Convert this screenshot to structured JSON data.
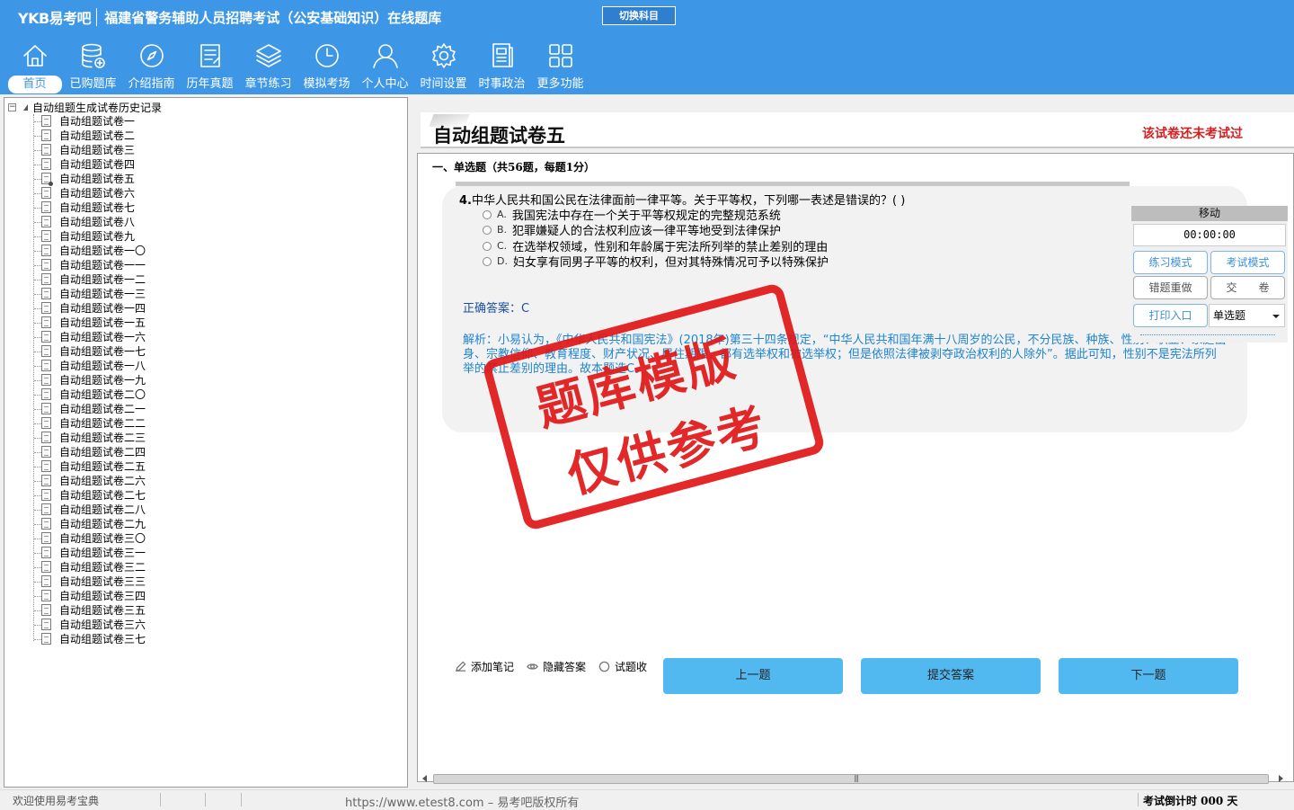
{
  "header": {
    "logo": "YKB易考吧",
    "app_title": "福建省警务辅助人员招聘考试（公安基础知识）在线题库",
    "switch_subject": "切换科目",
    "background_color": "#3d97e6"
  },
  "nav": [
    {
      "label": "首页",
      "icon": "home-icon",
      "active": true
    },
    {
      "label": "已购题库",
      "icon": "database-icon"
    },
    {
      "label": "介绍指南",
      "icon": "compass-icon"
    },
    {
      "label": "历年真题",
      "icon": "document-list-icon"
    },
    {
      "label": "章节练习",
      "icon": "layers-icon"
    },
    {
      "label": "模拟考场",
      "icon": "clock-icon"
    },
    {
      "label": "个人中心",
      "icon": "user-icon"
    },
    {
      "label": "时间设置",
      "icon": "gear-icon"
    },
    {
      "label": "时事政治",
      "icon": "newspaper-icon"
    },
    {
      "label": "更多功能",
      "icon": "grid-icon"
    }
  ],
  "tree": {
    "root_label": "自动组题生成试卷历史记录",
    "items": [
      "自动组题试卷一",
      "自动组题试卷二",
      "自动组题试卷三",
      "自动组题试卷四",
      "自动组题试卷五",
      "自动组题试卷六",
      "自动组题试卷七",
      "自动组题试卷八",
      "自动组题试卷九",
      "自动组题试卷一〇",
      "自动组题试卷一一",
      "自动组题试卷一二",
      "自动组题试卷一三",
      "自动组题试卷一四",
      "自动组题试卷一五",
      "自动组题试卷一六",
      "自动组题试卷一七",
      "自动组题试卷一八",
      "自动组题试卷一九",
      "自动组题试卷二〇",
      "自动组题试卷二一",
      "自动组题试卷二二",
      "自动组题试卷二三",
      "自动组题试卷二四",
      "自动组题试卷二五",
      "自动组题试卷二六",
      "自动组题试卷二七",
      "自动组题试卷二八",
      "自动组题试卷二九",
      "自动组题试卷三〇",
      "自动组题试卷三一",
      "自动组题试卷三二",
      "自动组题试卷三三",
      "自动组题试卷三四",
      "自动组题试卷三五",
      "自动组题试卷三六",
      "自动组题试卷三七"
    ],
    "selected_index": 4
  },
  "paper": {
    "title": "自动组题试卷五",
    "status": "该试卷还未考试过",
    "section_title": "一、单选题（共56题，每题1分）"
  },
  "question": {
    "number": "4.",
    "text": "中华人民共和国公民在法律面前一律平等。关于平等权，下列哪一表述是错误的？( )",
    "options": [
      {
        "key": "A.",
        "text": "我国宪法中存在一个关于平等权规定的完整规范系统"
      },
      {
        "key": "B.",
        "text": "犯罪嫌疑人的合法权利应该一律平等地受到法律保护"
      },
      {
        "key": "C.",
        "text": "在选举权领域，性别和年龄属于宪法所列举的禁止差别的理由"
      },
      {
        "key": "D.",
        "text": "妇女享有同男子平等的权利，但对其特殊情况可予以特殊保护"
      }
    ],
    "answer_label": "正确答案：",
    "answer_value": "C",
    "analysis_label": "解析：",
    "analysis_text": "小易认为，《中华人民共和国宪法》(2018年)第三十四条规定，“中华人民共和国年满十八周岁的公民，不分民族、种族、性别、职业、家庭出身、宗教信仰、教育程度、财产状况、居住期限，都有选举权和被选举权；但是依照法律被剥夺政治权利的人除外”。据此可知，性别不是宪法所列举的禁止差别的理由。故本题选C。"
  },
  "control_panel": {
    "move_label": "移动",
    "timer": "00:00:00",
    "practice_mode": "练习模式",
    "exam_mode": "考试模式",
    "redo_wrong": "错题重做",
    "submit_paper": "交　　卷",
    "print_entry": "打印入口",
    "question_type": "单选题"
  },
  "bottom_bar": {
    "add_note": "添加笔记",
    "hide_answer": "隐藏答案",
    "favorite": "试题收",
    "prev": "上一题",
    "submit_answer": "提交答案",
    "next": "下一题",
    "button_color": "#52b8f0"
  },
  "status_bar": {
    "welcome": "欢迎使用易考宝典",
    "copyright": "https://www.etest8.com – 易考吧版权所有",
    "countdown": "考试倒计时 000 天"
  },
  "watermark": {
    "line1": "题库模版",
    "line2": "仅供参考",
    "color": "#e01818"
  }
}
